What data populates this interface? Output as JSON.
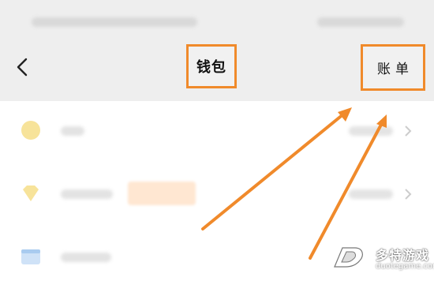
{
  "header": {
    "title": "钱包",
    "bill_label": "账单"
  },
  "watermark": {
    "title": "多特游戏",
    "url": "duotegame.com"
  },
  "colors": {
    "annotation": "#f08a2b",
    "header_bg": "#eeeeee",
    "icon_yellow": "#f7e39a",
    "icon_blue": "#cfe2f7"
  },
  "icons": {
    "back": "chevron-left-icon",
    "item1": "coin-icon",
    "item2": "diamond-icon",
    "item3": "card-icon",
    "row_arrow": "chevron-right-icon"
  }
}
